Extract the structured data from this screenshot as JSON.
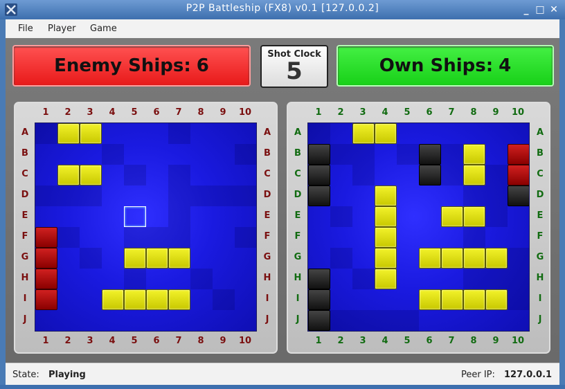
{
  "window": {
    "title": "P2P Battleship (FX8) v0.1 [127.0.0.2]"
  },
  "menu": {
    "items": [
      "File",
      "Player",
      "Game"
    ]
  },
  "scores": {
    "enemy": {
      "label": "Enemy Ships:",
      "value": "6",
      "color": "#f23b3b"
    },
    "own": {
      "label": "Own Ships:",
      "value": "4",
      "color": "#2fe02f"
    }
  },
  "clock": {
    "label": "Shot Clock",
    "value": "5"
  },
  "grid": {
    "columns": [
      "1",
      "2",
      "3",
      "4",
      "5",
      "6",
      "7",
      "8",
      "9",
      "10"
    ],
    "rows": [
      "A",
      "B",
      "C",
      "D",
      "E",
      "F",
      "G",
      "H",
      "I",
      "J"
    ]
  },
  "enemy_board": {
    "ships": [
      [
        0,
        1
      ],
      [
        0,
        2
      ],
      [
        2,
        1
      ],
      [
        2,
        2
      ],
      [
        6,
        4
      ],
      [
        6,
        5
      ],
      [
        6,
        6
      ],
      [
        8,
        3
      ],
      [
        8,
        4
      ],
      [
        8,
        5
      ],
      [
        8,
        6
      ]
    ],
    "hits": [
      [
        5,
        0
      ],
      [
        6,
        0
      ],
      [
        7,
        0
      ],
      [
        8,
        0
      ]
    ],
    "misses": [],
    "cursor": [
      4,
      4
    ]
  },
  "own_board": {
    "ships": [
      [
        0,
        2
      ],
      [
        0,
        3
      ],
      [
        1,
        7
      ],
      [
        2,
        7
      ],
      [
        3,
        3
      ],
      [
        4,
        3
      ],
      [
        5,
        3
      ],
      [
        6,
        3
      ],
      [
        7,
        3
      ],
      [
        4,
        6
      ],
      [
        4,
        7
      ],
      [
        6,
        5
      ],
      [
        6,
        6
      ],
      [
        6,
        7
      ],
      [
        6,
        8
      ],
      [
        8,
        5
      ],
      [
        8,
        6
      ],
      [
        8,
        7
      ],
      [
        8,
        8
      ]
    ],
    "hits": [
      [
        1,
        9
      ],
      [
        2,
        9
      ]
    ],
    "misses": [
      [
        1,
        0
      ],
      [
        2,
        0
      ],
      [
        3,
        0
      ],
      [
        1,
        5
      ],
      [
        2,
        5
      ],
      [
        3,
        9
      ],
      [
        7,
        0
      ],
      [
        8,
        0
      ],
      [
        9,
        0
      ]
    ],
    "cursor": null
  },
  "status": {
    "state_label": "State:",
    "state_value": "Playing",
    "peer_label": "Peer IP:",
    "peer_value": "127.0.0.1"
  },
  "colors": {
    "ship": "#e0e010",
    "hit": "#b01010",
    "miss": "#1a1a1a",
    "water": "#1a1ae0"
  }
}
